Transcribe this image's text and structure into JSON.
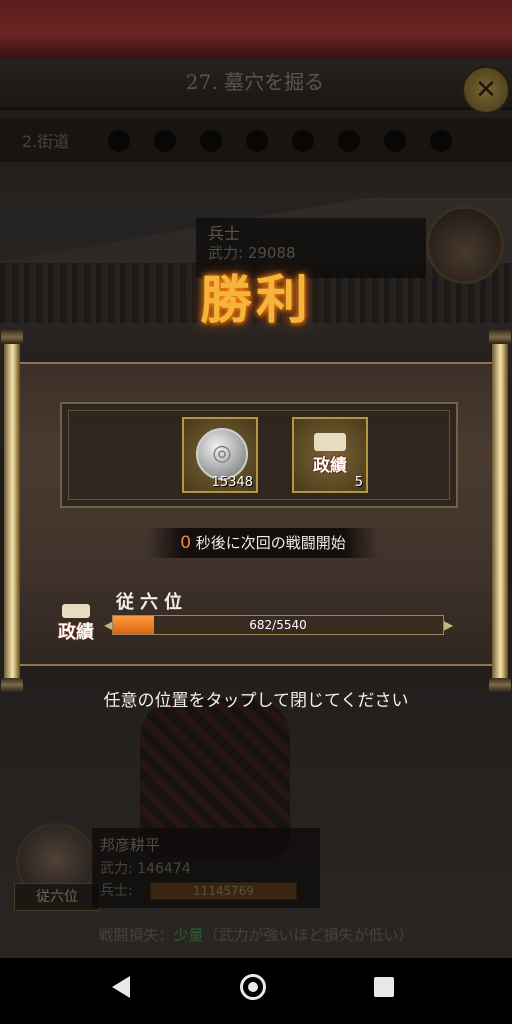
{
  "stage": {
    "title": "27. 墓穴を掘る",
    "close_icon": "close-icon",
    "street_label": "2.街道",
    "progress_dots": 8
  },
  "enemy": {
    "name": "兵士",
    "power": "武力: 29088"
  },
  "victory": {
    "text": "勝利"
  },
  "rewards": {
    "items": [
      {
        "icon": "silver-coin-icon",
        "count": "15348"
      },
      {
        "icon": "merit-scroll-icon",
        "label": "政績",
        "count": "5"
      }
    ]
  },
  "countdown": {
    "number": "0",
    "text": "秒後に次回の戦闘開始"
  },
  "rank": {
    "title": "従六位",
    "icon_label": "政績",
    "progress_text": "682/5540",
    "current": 682,
    "max": 5540
  },
  "tap_hint": "任意の位置をタップして閉じてください",
  "player": {
    "name": "邦彦耕平",
    "power": "武力: 146474",
    "troops_label": "兵士:",
    "troops": "11145769",
    "rank_badge": "従六位"
  },
  "battle_loss": {
    "prefix": "戦闘損失：",
    "level": "少量",
    "note": "（武力が強いほど損失が低い）"
  },
  "colors": {
    "victory": "#f4b53a",
    "progress_fill": "#e27420",
    "countdown_number": "#f08a3a",
    "loss_level": "#4d8f4b"
  },
  "nav": {
    "back_icon": "back-triangle-icon",
    "home_icon": "home-circle-icon",
    "recent_icon": "recent-apps-icon"
  }
}
